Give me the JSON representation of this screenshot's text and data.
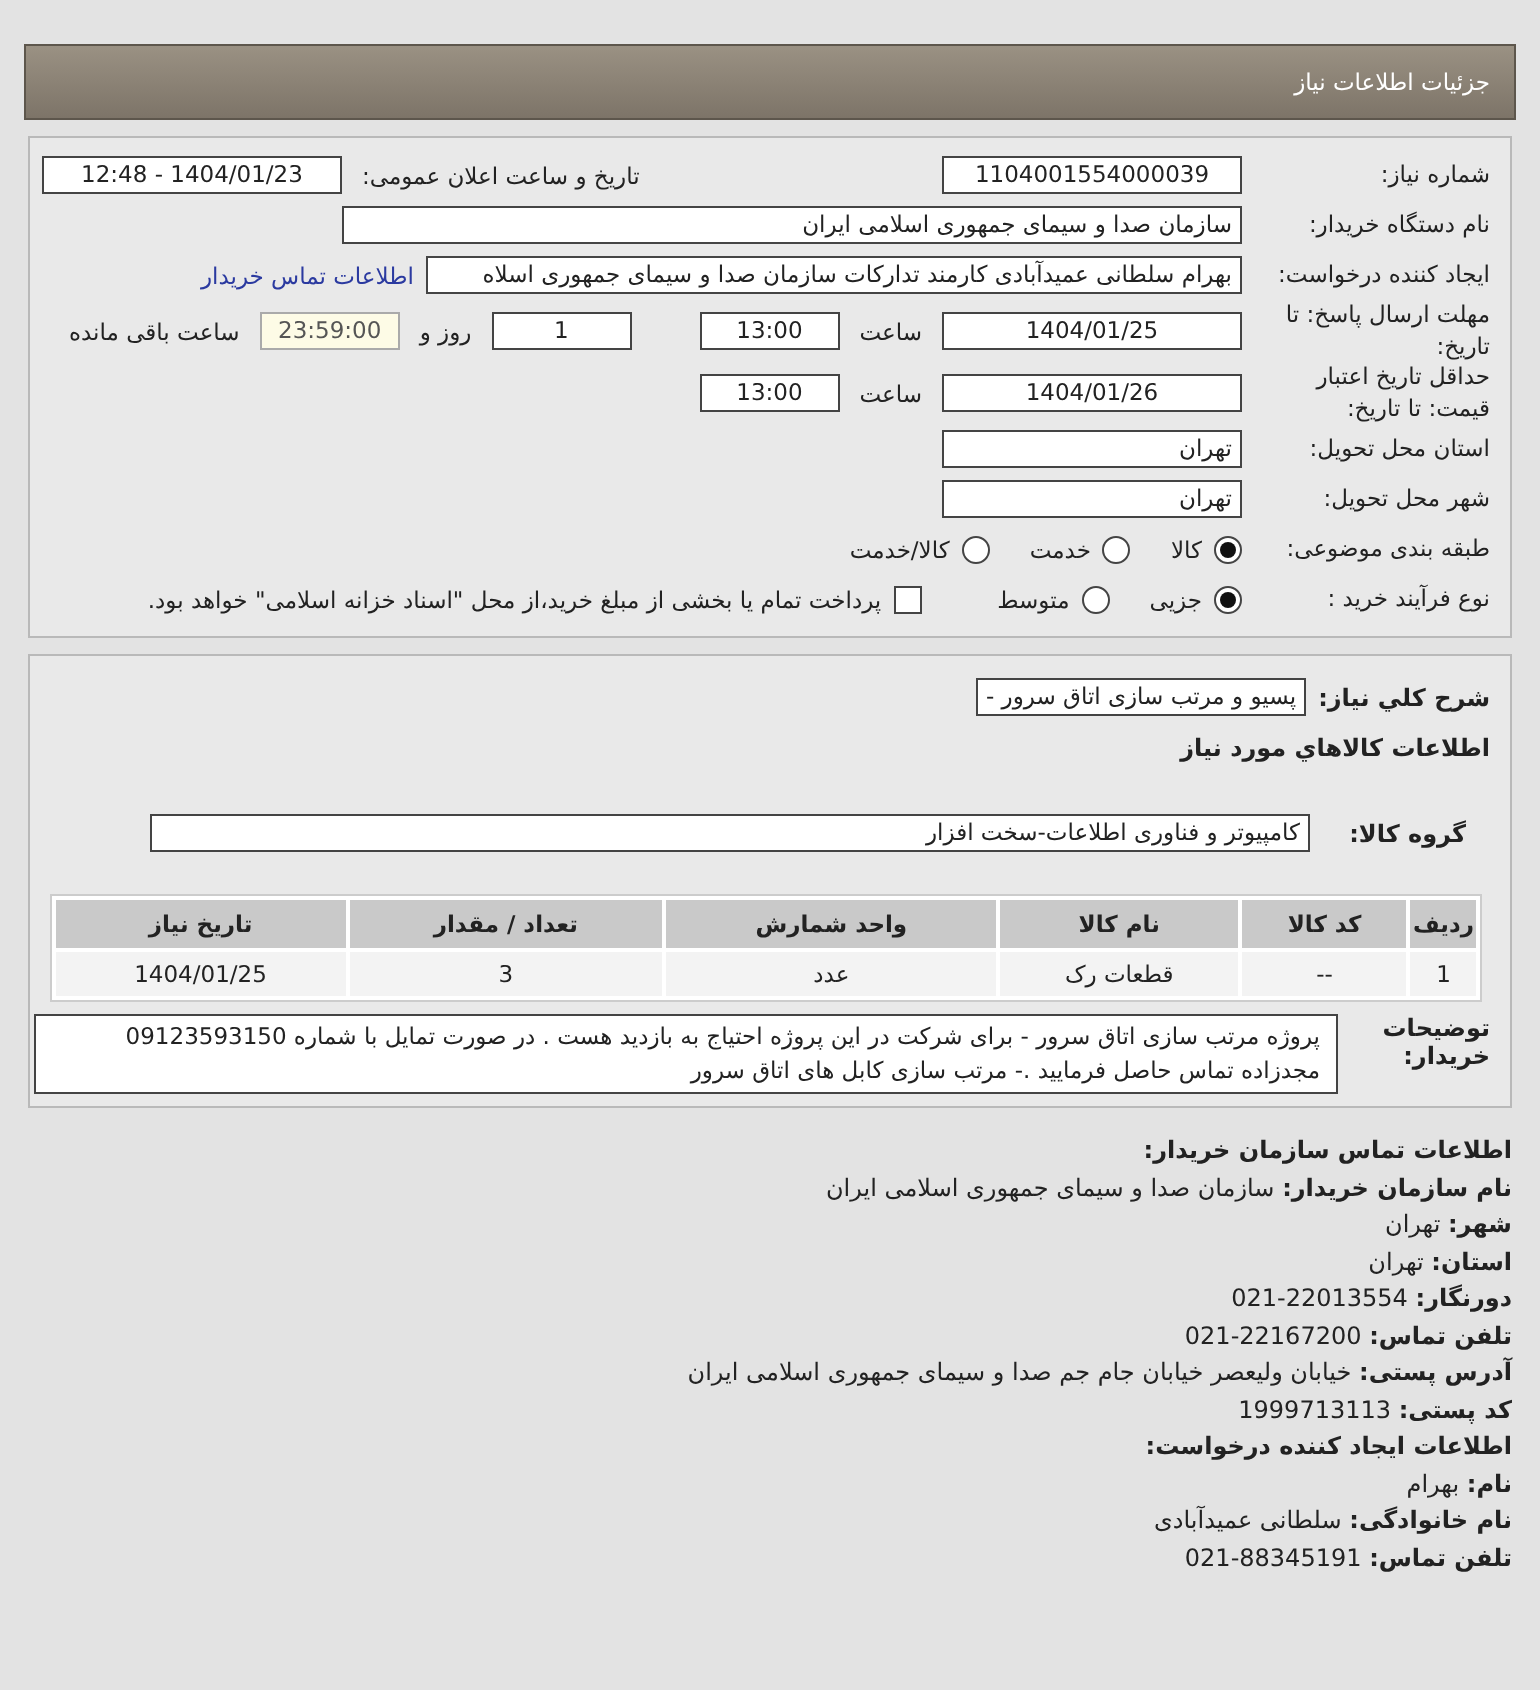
{
  "header": {
    "title": "جزئیات اطلاعات نیاز"
  },
  "details": {
    "need_number": {
      "label": "شماره نیاز:",
      "value": "1104001554000039"
    },
    "announce": {
      "label": "تاریخ و ساعت اعلان عمومی:",
      "value": "1404/01/23 - 12:48"
    },
    "buyer_org": {
      "label": "نام دستگاه خریدار:",
      "value": "سازمان صدا و سیمای جمهوری اسلامی ایران"
    },
    "creator": {
      "label": "ایجاد کننده درخواست:",
      "value": "بهرام سلطانی عمیدآبادی کارمند تدارکات سازمان صدا و سیمای جمهوری اسلاه",
      "link": "اطلاعات تماس خریدار"
    },
    "reply_deadline": {
      "label": "مهلت ارسال پاسخ: تا تاریخ:",
      "date": "1404/01/25",
      "time_label": "ساعت",
      "time": "13:00",
      "days": "1",
      "days_label": "روز و",
      "remaining": "23:59:00",
      "remaining_label": "ساعت باقی مانده"
    },
    "price_validity": {
      "label": "حداقل تاریخ اعتبار قیمت: تا تاریخ:",
      "date": "1404/01/26",
      "time_label": "ساعت",
      "time": "13:00"
    },
    "province": {
      "label": "استان محل تحویل:",
      "value": "تهران"
    },
    "city": {
      "label": "شهر محل تحویل:",
      "value": "تهران"
    },
    "category": {
      "label": "طبقه بندی موضوعی:",
      "options": [
        {
          "label": "کالا",
          "selected": true
        },
        {
          "label": "خدمت",
          "selected": false
        },
        {
          "label": "کالا/خدمت",
          "selected": false
        }
      ]
    },
    "process": {
      "label": "نوع فرآیند خرید :",
      "options": [
        {
          "label": "جزیی",
          "selected": true
        },
        {
          "label": "متوسط",
          "selected": false
        }
      ],
      "payment": {
        "checked": false,
        "text": "پرداخت تمام یا بخشی از مبلغ خرید،از محل \"اسناد خزانه اسلامی\" خواهد بود."
      }
    }
  },
  "goods": {
    "summary": {
      "label": "شرح کلي نياز:",
      "value": "پسیو و مرتب سازی اتاق سرور -"
    },
    "title": "اطلاعات کالاهاي مورد نياز",
    "group": {
      "label": "گروه کالا:",
      "value": "کامپیوتر و فناوری اطلاعات-سخت افزار"
    },
    "table": {
      "columns": [
        "ردیف",
        "کد کالا",
        "نام کالا",
        "واحد شمارش",
        "تعداد / مقدار",
        "تاریخ نیاز"
      ],
      "rows": [
        [
          "1",
          "--",
          "قطعات رک",
          "عدد",
          "3",
          "1404/01/25"
        ]
      ]
    },
    "notes": {
      "label": "توضیحات خریدار:",
      "value": "پروژه مرتب سازی اتاق سرور - برای شرکت در این پروژه احتیاج به بازدید هست . در صورت تمایل با شماره 09123593150 مجدزاده تماس حاصل فرمایید .- مرتب سازی کابل های اتاق سرور"
    }
  },
  "contact": [
    {
      "kind": "heading",
      "label": "اطلاعات تماس سازمان خریدار:"
    },
    {
      "kind": "field",
      "label": "نام سازمان خریدار:",
      "value": "سازمان صدا و سیمای جمهوری اسلامی ایران"
    },
    {
      "kind": "field",
      "label": "شهر:",
      "value": "تهران"
    },
    {
      "kind": "field",
      "label": "استان:",
      "value": "تهران"
    },
    {
      "kind": "field",
      "label": "دورنگار:",
      "value": "22013554-021"
    },
    {
      "kind": "field",
      "label": "تلفن تماس:",
      "value": "22167200-021"
    },
    {
      "kind": "field",
      "label": "آدرس پستی:",
      "value": "خیابان ولیعصر خیابان جام جم صدا و سیمای جمهوری اسلامی ایران"
    },
    {
      "kind": "field",
      "label": "کد پستی:",
      "value": "1999713113"
    },
    {
      "kind": "heading",
      "label": "اطلاعات ایجاد کننده درخواست:"
    },
    {
      "kind": "field",
      "label": "نام:",
      "value": "بهرام"
    },
    {
      "kind": "field",
      "label": "نام خانوادگی:",
      "value": "سلطانی عمیدآبادی"
    },
    {
      "kind": "field",
      "label": "تلفن تماس:",
      "value": "88345191-021"
    }
  ]
}
